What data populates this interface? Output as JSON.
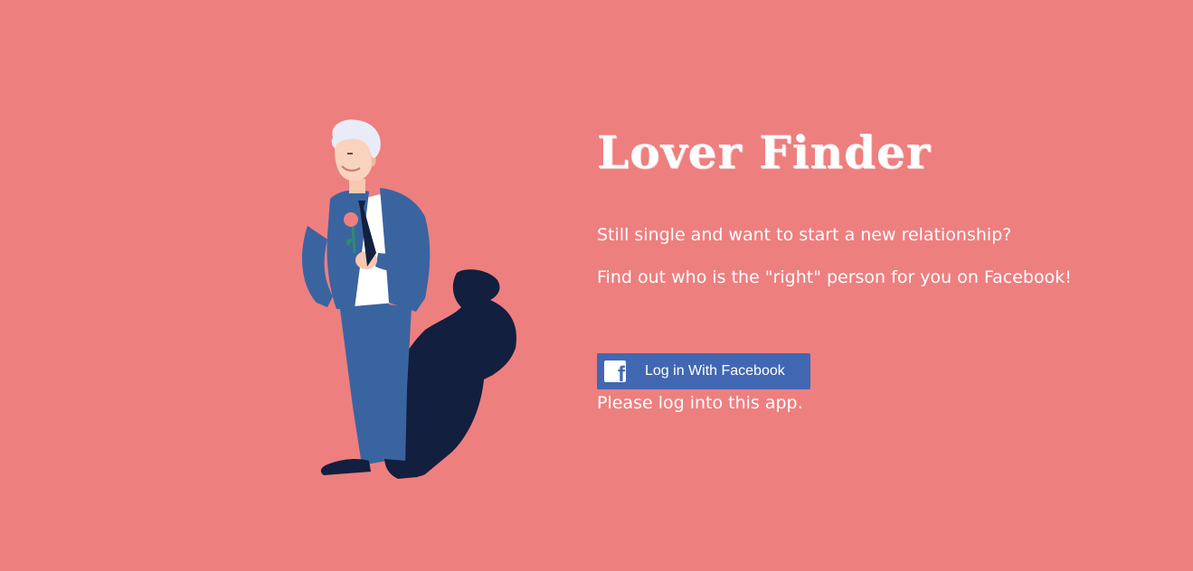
{
  "app": {
    "title": "Lover Finder"
  },
  "intro": {
    "line1": "Still single and want to start a new relationship?",
    "line2": "Find out who is the \"right\" person for you on Facebook!"
  },
  "login": {
    "button_label": "Log in With Facebook",
    "icon": "facebook-logo-icon",
    "status": "Please log into this app."
  },
  "illustration": {
    "subject": "man-in-blue-suit-holding-rose-icon"
  },
  "colors": {
    "background": "#ee7f7f",
    "text": "#ffffff",
    "facebook_blue": "#4267b2",
    "suit_blue": "#3a64a0",
    "shadow_navy": "#131f3f"
  }
}
